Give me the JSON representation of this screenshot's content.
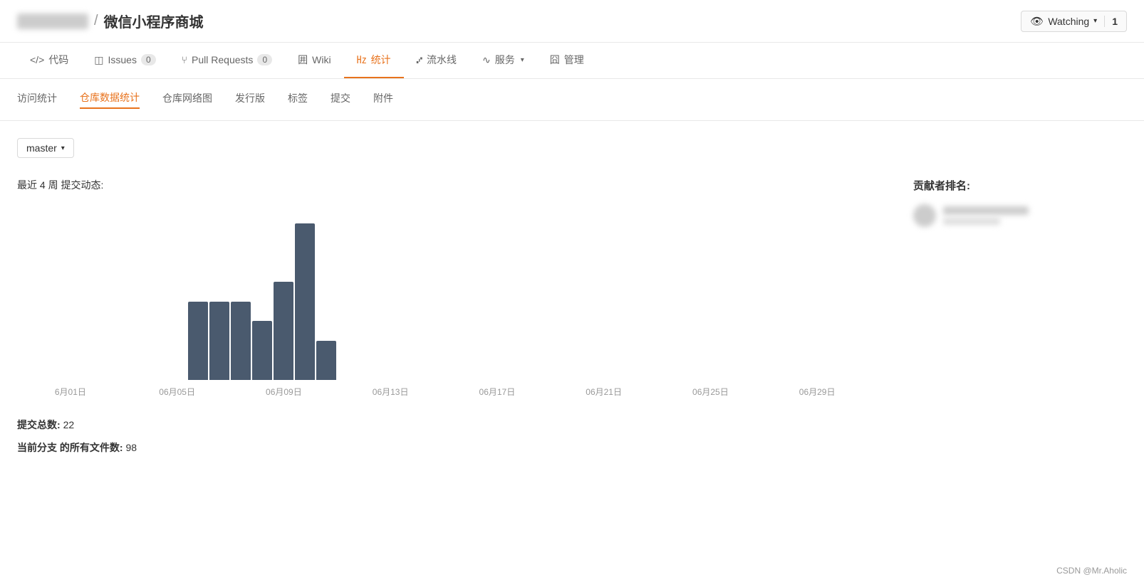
{
  "header": {
    "repo_name": "微信小程序商城",
    "separator": "/",
    "watching_label": "Watching",
    "watching_count": "1"
  },
  "nav": {
    "tabs": [
      {
        "id": "code",
        "icon": "</>",
        "label": "代码",
        "active": false
      },
      {
        "id": "issues",
        "icon": "◫",
        "label": "Issues",
        "badge": "0",
        "active": false
      },
      {
        "id": "pulls",
        "icon": "⑂",
        "label": "Pull Requests",
        "badge": "0",
        "active": false
      },
      {
        "id": "wiki",
        "icon": "囲",
        "label": "Wiki",
        "active": false
      },
      {
        "id": "stats",
        "icon": "㎐",
        "label": "统计",
        "active": true
      },
      {
        "id": "pipeline",
        "icon": "⑇",
        "label": "流水线",
        "active": false
      },
      {
        "id": "services",
        "icon": "∿",
        "label": "服务",
        "has_dropdown": true,
        "active": false
      },
      {
        "id": "manage",
        "icon": "囧",
        "label": "管理",
        "active": false
      }
    ]
  },
  "subnav": {
    "items": [
      {
        "id": "visit-stats",
        "label": "访问统计",
        "active": false
      },
      {
        "id": "repo-data-stats",
        "label": "仓库数据统计",
        "active": true
      },
      {
        "id": "repo-network",
        "label": "仓库网络图",
        "active": false
      },
      {
        "id": "releases",
        "label": "发行版",
        "active": false
      },
      {
        "id": "tags",
        "label": "标签",
        "active": false
      },
      {
        "id": "commits",
        "label": "提交",
        "active": false
      },
      {
        "id": "attachments",
        "label": "附件",
        "active": false
      }
    ]
  },
  "branch": {
    "selected": "master"
  },
  "chart": {
    "title": "最近 4 周 提交动态:",
    "bars": [
      0,
      0,
      0,
      0,
      0,
      0,
      0,
      0,
      0,
      0,
      4,
      4,
      4,
      3,
      5,
      8,
      2
    ],
    "max_height": 220,
    "x_labels": [
      "6月01日",
      "06月05日",
      "06月09日",
      "06月13日",
      "06月17日",
      "06月21日",
      "06月25日",
      "06月29日"
    ]
  },
  "stats": {
    "total_commits_label": "提交总数:",
    "total_commits_value": "22",
    "files_label": "当前分支 的所有文件数:",
    "files_value": "98"
  },
  "contributors": {
    "title": "贡献者排名:"
  },
  "footer": {
    "note": "CSDN @Mr.Aholic"
  }
}
